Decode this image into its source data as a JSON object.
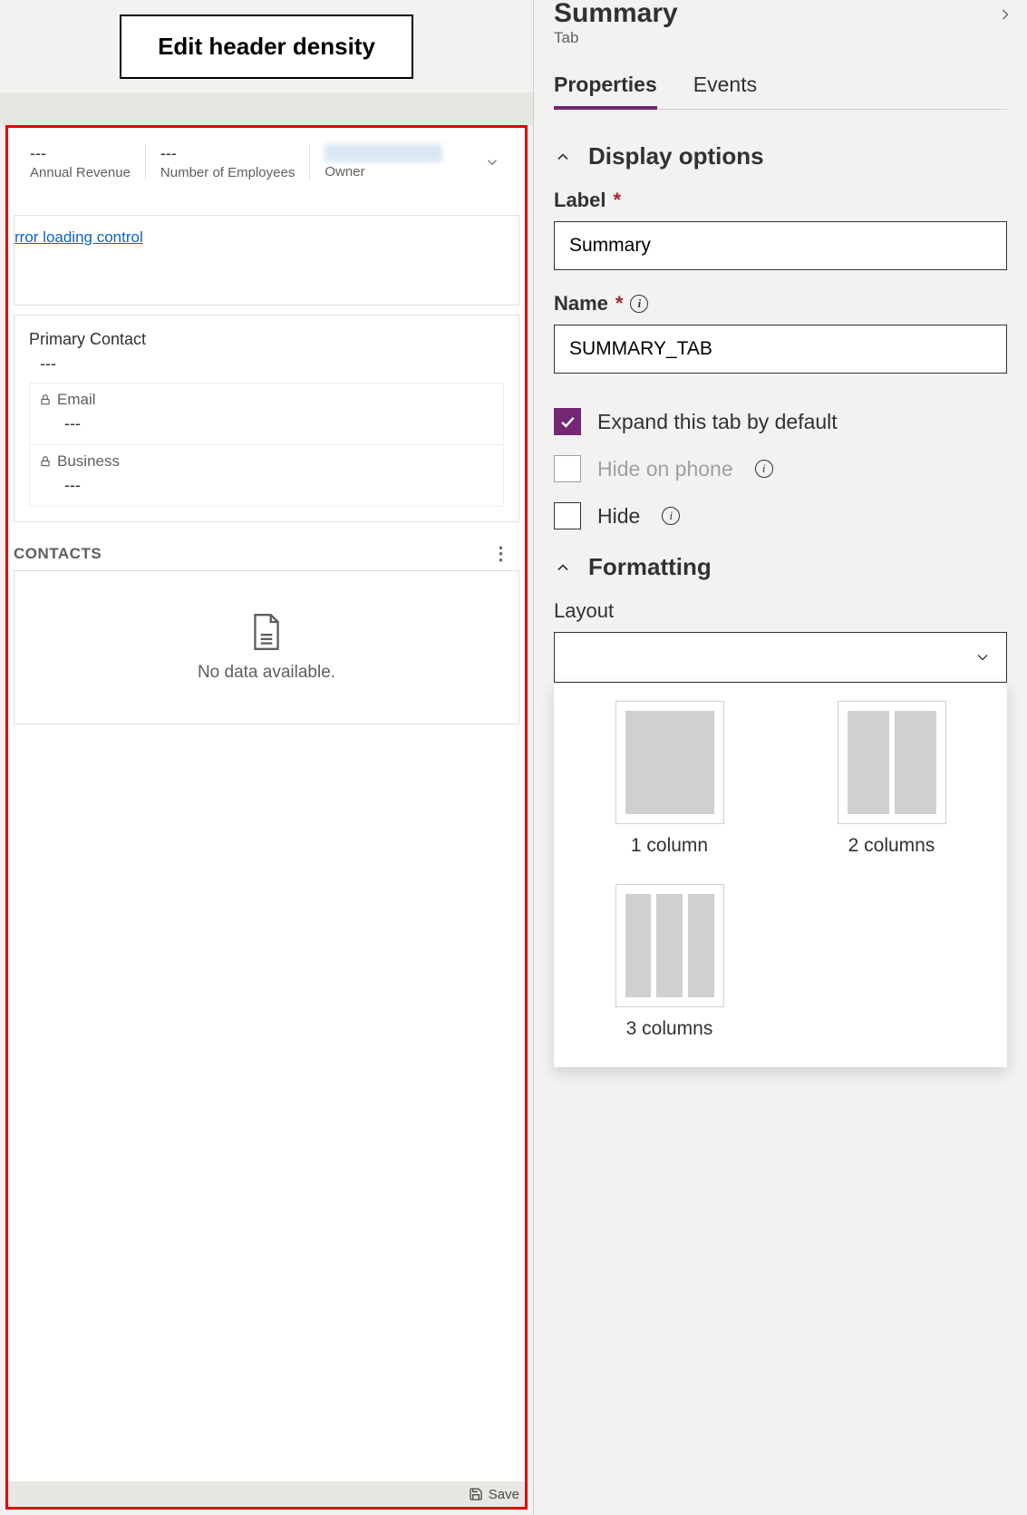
{
  "header": {
    "edit_button": "Edit header density"
  },
  "canvas": {
    "header_fields": [
      {
        "value": "---",
        "label": "Annual Revenue"
      },
      {
        "value": "---",
        "label": "Number of Employees"
      },
      {
        "value": "",
        "label": "Owner"
      }
    ],
    "error_text": "rror loading control",
    "primary_contact": {
      "label": "Primary Contact",
      "value": "---"
    },
    "email": {
      "label": "Email",
      "value": "---"
    },
    "business": {
      "label": "Business",
      "value": "---"
    },
    "contacts_heading": "CONTACTS",
    "no_data_text": "No data available.",
    "save_label": "Save"
  },
  "panel": {
    "title": "Summary",
    "subtitle": "Tab",
    "tabs": {
      "properties": "Properties",
      "events": "Events"
    },
    "display_section": "Display options",
    "label_field": {
      "label": "Label",
      "value": "Summary"
    },
    "name_field": {
      "label": "Name",
      "value": "SUMMARY_TAB"
    },
    "expand_cb": "Expand this tab by default",
    "hide_phone_cb": "Hide on phone",
    "hide_cb": "Hide",
    "formatting_section": "Formatting",
    "layout_label": "Layout",
    "layout_options": {
      "one": "1 column",
      "two": "2 columns",
      "three": "3 columns"
    }
  }
}
